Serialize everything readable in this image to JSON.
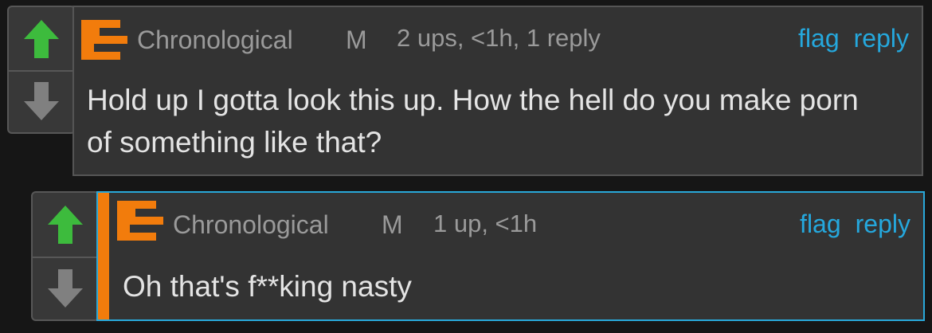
{
  "theme": {
    "op_color": "#f27c0c",
    "link_color": "#25a8dd",
    "upvote_color": "#3dbb3d",
    "downvote_color": "#808080",
    "highlight_border": "#29a8d9"
  },
  "comments": [
    {
      "username": "Chronological",
      "gender": "M",
      "meta": "2 ups, <1h, 1 reply",
      "flag_label": "flag",
      "reply_label": "reply",
      "text": "Hold up I gotta look this up. How the hell do you make porn of something like that?",
      "upvote_icon": "arrow-up-icon",
      "downvote_icon": "arrow-down-icon"
    },
    {
      "username": "Chronological",
      "gender": "M",
      "meta": "1 up, <1h",
      "flag_label": "flag",
      "reply_label": "reply",
      "text": "Oh that's f**king nasty",
      "upvote_icon": "arrow-up-icon",
      "downvote_icon": "arrow-down-icon"
    }
  ]
}
